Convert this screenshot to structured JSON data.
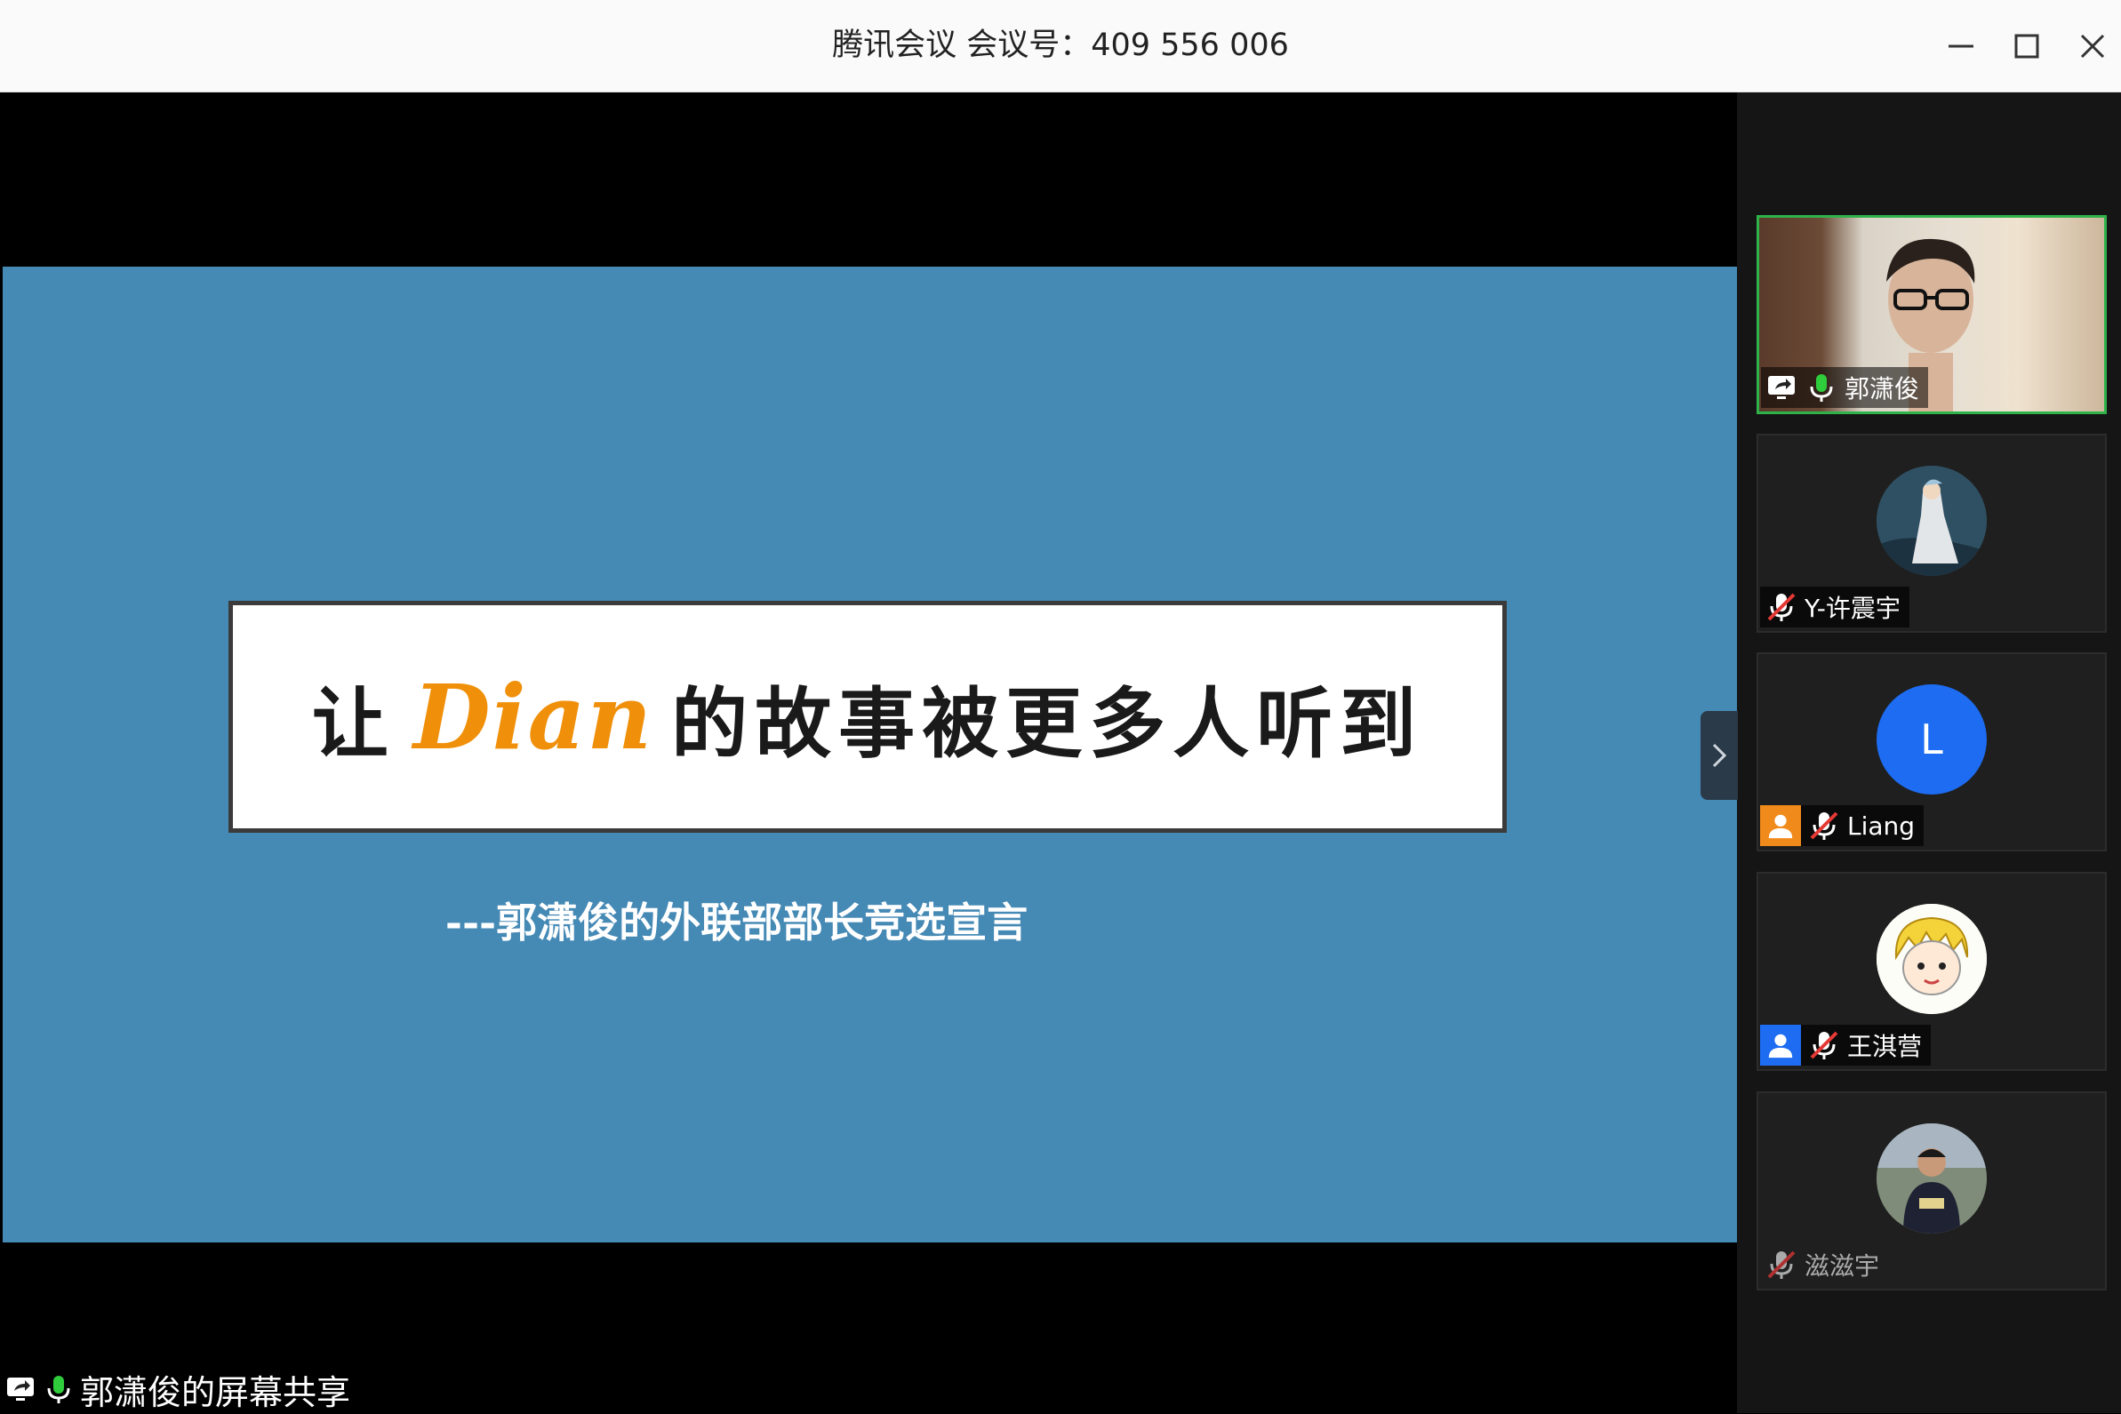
{
  "window": {
    "title": "腾讯会议 会议号：409 556 006"
  },
  "slide": {
    "title_before": "让",
    "title_brand": "Dian",
    "title_after": "的故事被更多人听到",
    "subtitle": "---郭潇俊的外联部部长竞选宣言"
  },
  "share": {
    "label": "郭潇俊的屏幕共享"
  },
  "participants": [
    {
      "name": "郭潇俊",
      "mic": "on",
      "sharing": true,
      "video": true
    },
    {
      "name": "Y-许震宇",
      "mic": "muted"
    },
    {
      "name": "Liang",
      "mic": "muted",
      "role": "host",
      "avatar_letter": "L"
    },
    {
      "name": "王淇营",
      "mic": "muted",
      "role": "co-host"
    },
    {
      "name": "滋滋宇",
      "mic": "muted"
    }
  ],
  "colors": {
    "slide_bg": "#4589b5",
    "brand": "#f0900a",
    "active_border": "#2fb24a",
    "host": "#f08a1a",
    "cohost": "#1d6cf2"
  }
}
